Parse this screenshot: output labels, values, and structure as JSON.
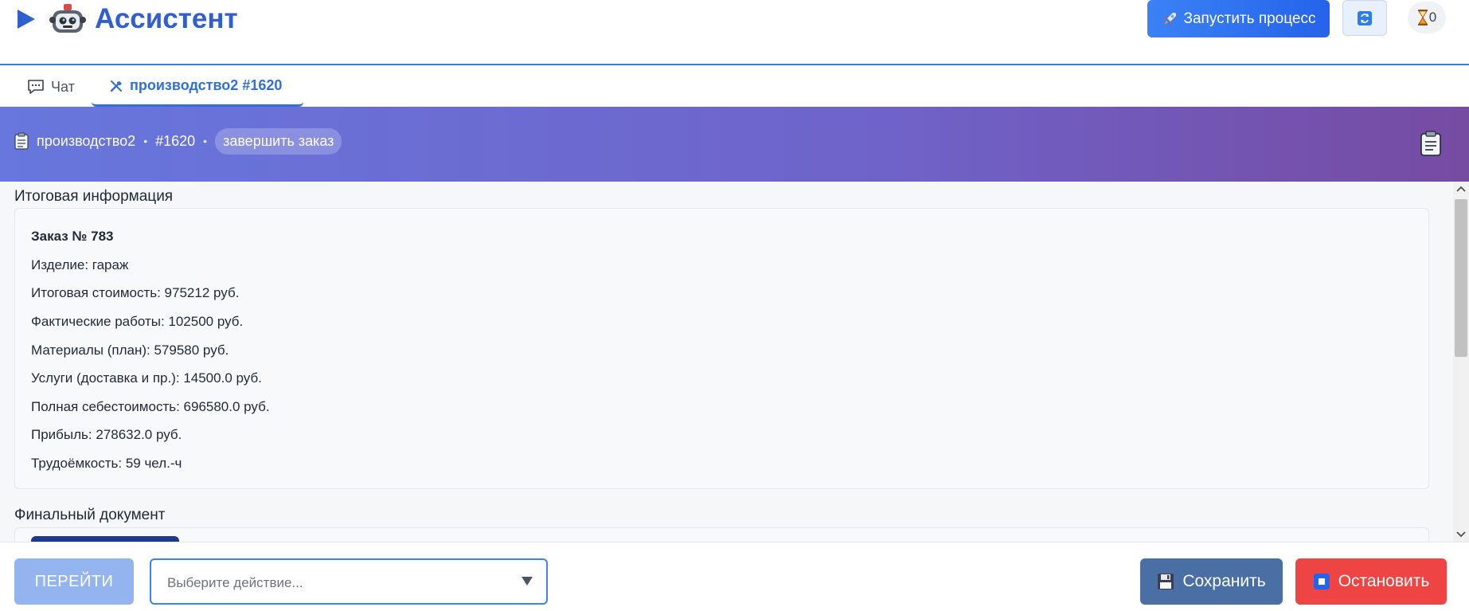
{
  "header": {
    "title": "Ассистент",
    "launch_label": "Запустить процесс",
    "queue_count": "0",
    "icons": [
      "play-icon",
      "robot-icon",
      "rocket-icon",
      "refresh-icon",
      "hourglass-icon"
    ]
  },
  "tabs": [
    {
      "label": "Чат",
      "icon": "chat-icon"
    },
    {
      "label": "производство2 #1620",
      "icon": "tools-icon",
      "active": true
    }
  ],
  "banner": {
    "process": "производство2",
    "number": "#1620",
    "step": "завершить заказ",
    "sep": "•"
  },
  "summary": {
    "title": "Итоговая информация",
    "lines": [
      "Заказ № 783",
      "Изделие: гараж",
      "Итоговая стоимость: 975212 руб.",
      "Фактические работы: 102500 руб.",
      "Материалы (план): 579580 руб.",
      "Услуги (доставка и пр.): 14500.0 руб.",
      "Полная себестоимость: 696580.0 руб.",
      "Прибыль: 278632.0 руб.",
      "Трудоёмкость: 59 чел.-ч"
    ]
  },
  "final_doc": {
    "title": "Финальный документ"
  },
  "footer": {
    "go_label": "ПЕРЕЙТИ",
    "select_placeholder": "Выберите действие...",
    "save_label": "Сохранить",
    "stop_label": "Остановить"
  },
  "colors": {
    "accent": "#2f6fe0",
    "banner_start": "#6777dd",
    "banner_end": "#764ba2",
    "save": "#4a6fa5",
    "stop": "#ef4444",
    "go_disabled": "#93b4ef"
  }
}
